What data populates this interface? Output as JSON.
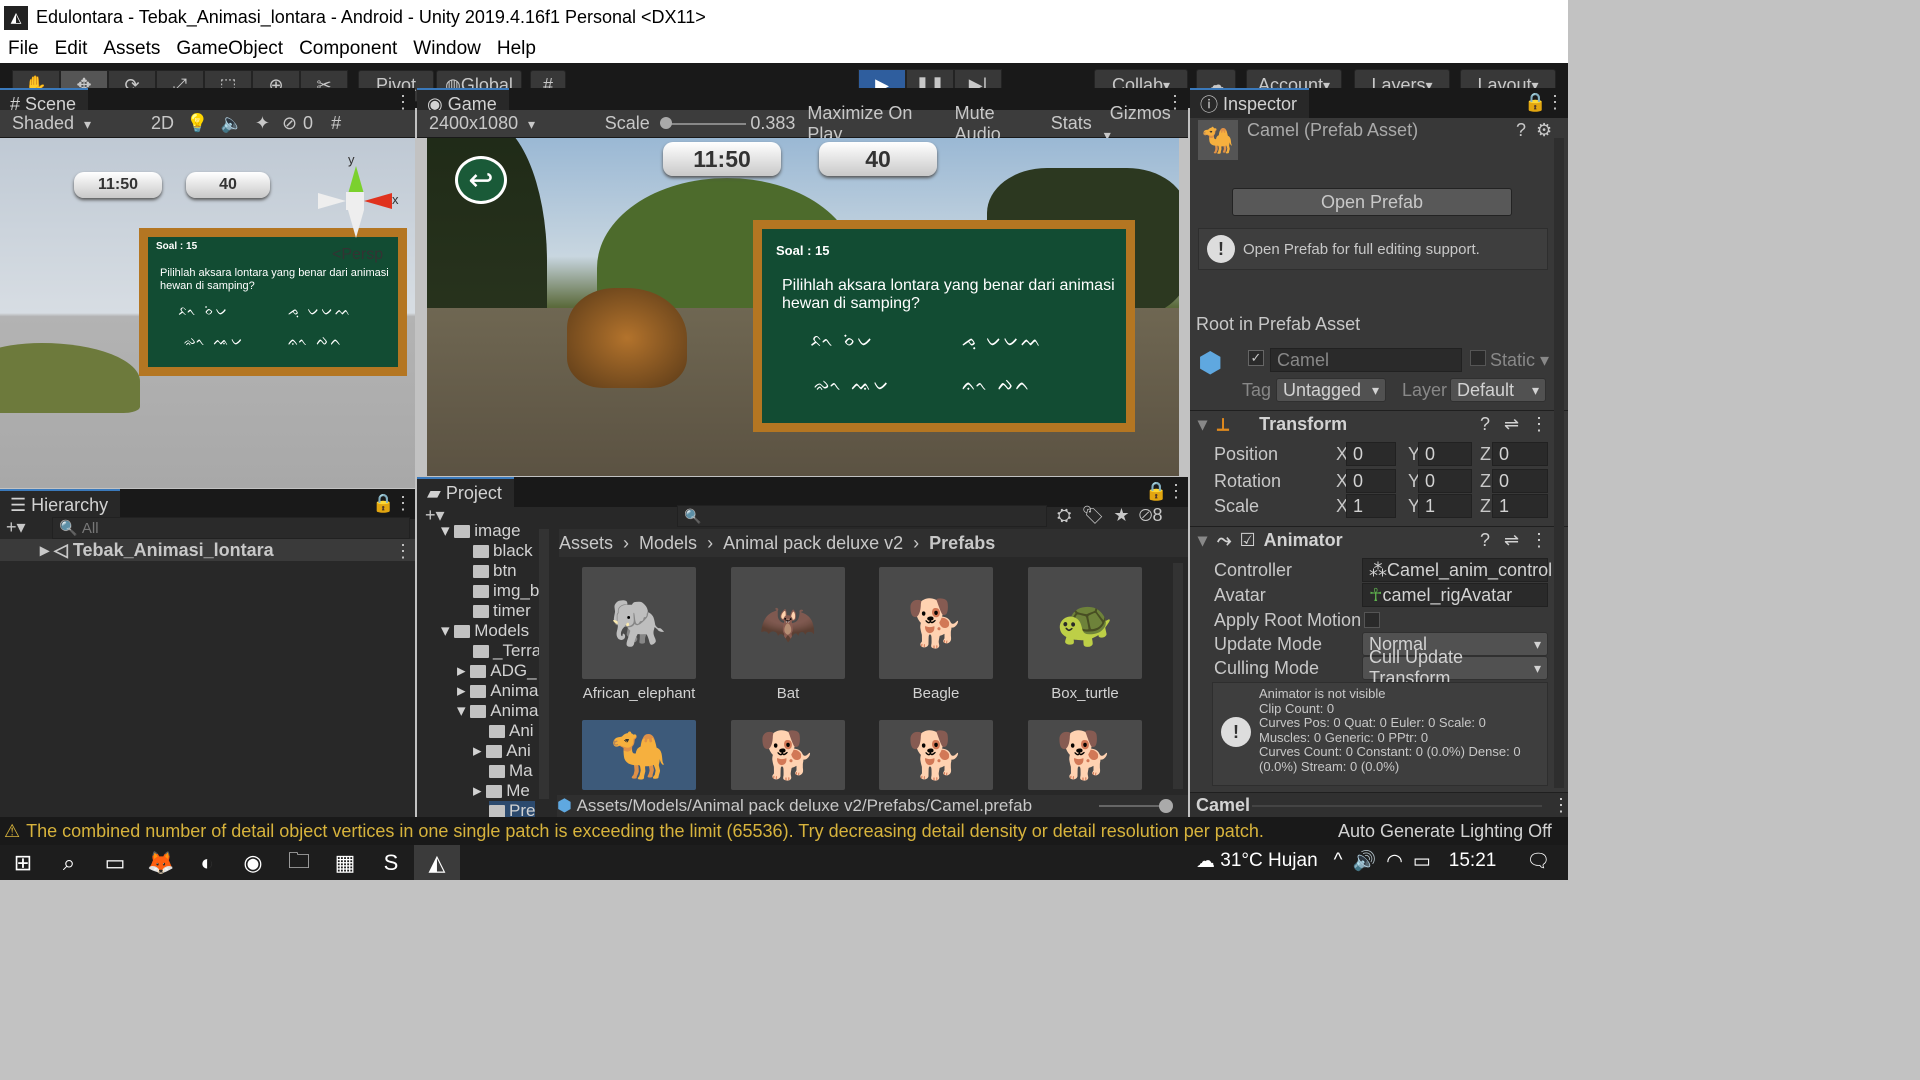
{
  "window": {
    "title": "Edulontara - Tebak_Animasi_lontara - Android - Unity 2019.4.16f1 Personal <DX11>",
    "controls": [
      "—",
      "❐",
      "✕"
    ]
  },
  "menu": [
    "File",
    "Edit",
    "Assets",
    "GameObject",
    "Component",
    "Window",
    "Help"
  ],
  "toolbar": {
    "pivot": "Pivot",
    "global": "Global",
    "collab": "Collab",
    "account": "Account",
    "layers": "Layers",
    "layout": "Layout"
  },
  "scene": {
    "tab": "Scene",
    "shading": "Shaded",
    "mode2d": "2D",
    "hidden_count": "0",
    "persp": "Persp",
    "gizmo_y": "y",
    "gizmo_x": "x",
    "timer": "11:50",
    "score": "40",
    "board_title": "Soal : 15",
    "question": "Pilihlah aksara lontara yang benar dari animasi hewan di samping?",
    "opt1": "ᨅᨚ ᨔᨗᨆ",
    "opt2": "ᨍᨘ ᨆᨆᨓ",
    "opt3": "ᨋᨚ ᨕᨆ",
    "opt4": "ᨊᨚ ᨄᨈ"
  },
  "game": {
    "tab": "Game",
    "resolution": "2400x1080",
    "scale_label": "Scale",
    "scale_value": "0.383",
    "maximize": "Maximize On Play",
    "mute": "Mute Audio",
    "stats": "Stats",
    "gizmos": "Gizmos",
    "timer": "11:50",
    "score": "40",
    "board_title": "Soal : 15",
    "question": "Pilihlah aksara lontara yang benar dari animasi hewan di samping?",
    "opt1": "ᨅᨚ ᨔᨗᨆ",
    "opt2": "ᨍᨘ ᨆᨆᨓ",
    "opt3": "ᨋᨚ ᨕᨆ",
    "opt4": "ᨊᨚ ᨄᨈ"
  },
  "hierarchy": {
    "tab": "Hierarchy",
    "search_placeholder": "All",
    "root": "Tebak_Animasi_lontara"
  },
  "project": {
    "tab": "Project",
    "hidden_count": "8",
    "tree": [
      "image",
      "black",
      "btn",
      "img_b",
      "timer",
      "Models",
      "_Terra",
      "ADG_",
      "Anima",
      "Anima",
      "Ani",
      "Ani",
      "Ma",
      "Me",
      "Pre"
    ],
    "breadcrumb": [
      "Assets",
      "Models",
      "Animal pack deluxe v2",
      "Prefabs"
    ],
    "assets": [
      "African_elephant",
      "Bat",
      "Beagle",
      "Box_turtle"
    ],
    "path": "Assets/Models/Animal pack deluxe v2/Prefabs/Camel.prefab"
  },
  "inspector": {
    "tab": "Inspector",
    "asset_title": "Camel (Prefab Asset)",
    "open_prefab": "Open Prefab",
    "info": "Open Prefab for full editing support.",
    "root_label": "Root in Prefab Asset",
    "name": "Camel",
    "static": "Static",
    "tag_label": "Tag",
    "tag": "Untagged",
    "layer_label": "Layer",
    "layer": "Default",
    "transform": "Transform",
    "position": "Position",
    "rotation": "Rotation",
    "scale": "Scale",
    "pos": [
      "0",
      "0",
      "0"
    ],
    "rot": [
      "0",
      "0",
      "0"
    ],
    "scl": [
      "1",
      "1",
      "1"
    ],
    "axis": [
      "X",
      "Y",
      "Z"
    ],
    "animator": "Animator",
    "controller_label": "Controller",
    "controller": "Camel_anim_control",
    "avatar_label": "Avatar",
    "avatar": "camel_rigAvatar",
    "apply_root": "Apply Root Motion",
    "update_label": "Update Mode",
    "update": "Normal",
    "culling_label": "Culling Mode",
    "culling": "Cull Update Transform",
    "anim_info": [
      "Animator is not visible",
      "Clip Count: 0",
      "Curves Pos: 0 Quat: 0 Euler: 0 Scale: 0",
      "Muscles: 0 Generic: 0 PPtr: 0",
      "Curves Count: 0 Constant: 0 (0.0%) Dense: 0",
      "(0.0%) Stream: 0 (0.0%)"
    ],
    "footer": "Camel"
  },
  "status": {
    "warning": "The combined number of detail object vertices in one single patch is exceeding the limit (65536). Try decreasing detail density or detail resolution per patch.",
    "lighting": "Auto Generate Lighting Off"
  },
  "taskbar": {
    "weather": "31°C Hujan",
    "time": "15:21"
  }
}
